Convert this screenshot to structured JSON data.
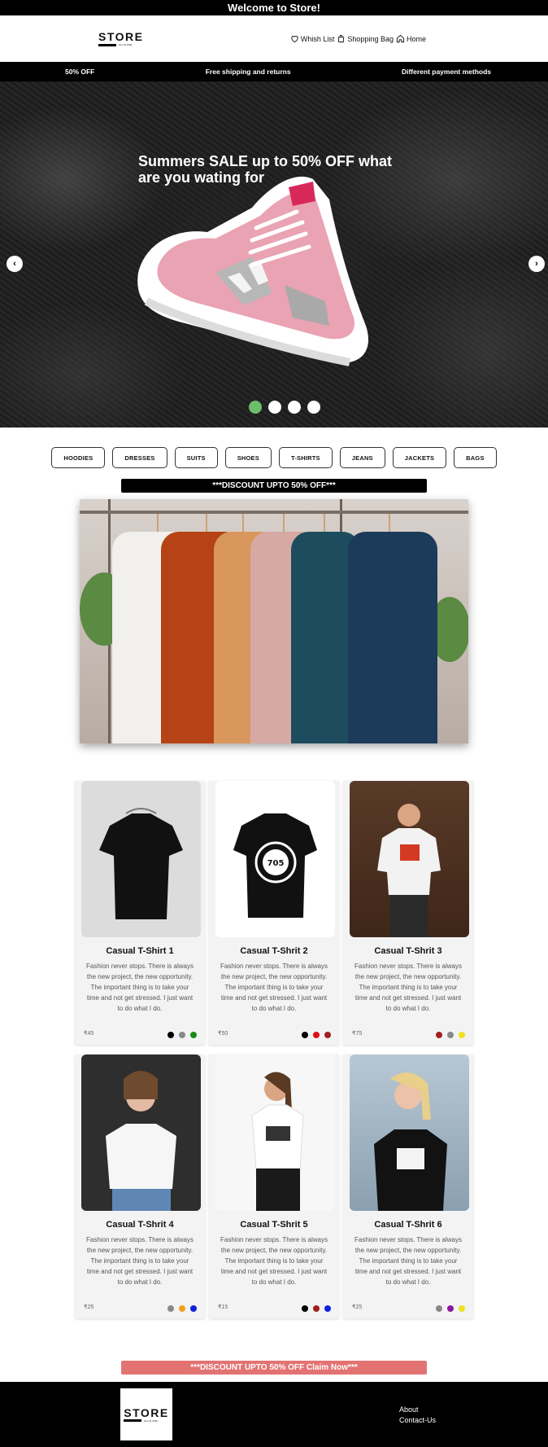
{
  "topbar": {
    "text": "Welcome to Store!"
  },
  "nav": {
    "logo": "STORE",
    "logo_tagline": "ALL IN ONE",
    "links": [
      {
        "label": "Whish List",
        "icon": "heart-icon"
      },
      {
        "label": "Shopping Bag",
        "icon": "bag-icon"
      },
      {
        "label": "Home",
        "icon": "home-icon"
      }
    ]
  },
  "promo": {
    "left": "50% OFF",
    "center": "Free shipping and returns",
    "right": "Different payment methods"
  },
  "hero": {
    "title": "Summers SALE up to 50% OFF what are you wating for",
    "prev_icon": "chevron-left-icon",
    "next_icon": "chevron-right-icon",
    "slides": 4,
    "active_slide": 1,
    "active_color": "#6bbf6b"
  },
  "categories": [
    "HOODIES",
    "DRESSES",
    "SUITS",
    "SHOES",
    "T-SHIRTS",
    "JEANS",
    "JACKETS",
    "BAGS"
  ],
  "discount_banner": "***DISCOUNT UPTO 50% OFF***",
  "products": [
    {
      "name": "Casual T-Shirt 1",
      "desc": "Fashion never stops. There is always the new project, the new opportunity. The important thing is to take your time and not get stressed. I just want to do what I do.",
      "price": "₹45",
      "colors": [
        "#000000",
        "#888888",
        "#1a8a1a"
      ]
    },
    {
      "name": "Casual T-Shrit 2",
      "desc": "Fashion never stops. There is always the new project, the new opportunity. The important thing is to take your time and not get stressed. I just want to do what I do.",
      "price": "₹50",
      "colors": [
        "#000000",
        "#e01010",
        "#a01f1f"
      ]
    },
    {
      "name": "Casual T-Shrit 3",
      "desc": "Fashion never stops. There is always the new project, the new opportunity. The important thing is to take your time and not get stressed. I just want to do what I do.",
      "price": "₹75",
      "colors": [
        "#a01f1f",
        "#888888",
        "#f0e020"
      ]
    },
    {
      "name": "Casual T-Shrit 4",
      "desc": "Fashion never stops. There is always the new project, the new opportunity. The important thing is to take your time and not get stressed. I just want to do what I do.",
      "price": "₹25",
      "colors": [
        "#888888",
        "#f0a020",
        "#1020e0"
      ]
    },
    {
      "name": "Casual T-Shrit 5",
      "desc": "Fashion never stops. There is always the new project, the new opportunity. The important thing is to take your time and not get stressed. I just want to do what I do.",
      "price": "₹15",
      "colors": [
        "#000000",
        "#a01f1f",
        "#1020e0"
      ]
    },
    {
      "name": "Casual T-Shrit 6",
      "desc": "Fashion never stops. There is always the new project, the new opportunity. The important thing is to take your time and not get stressed. I just want to do what I do.",
      "price": "₹25",
      "colors": [
        "#888888",
        "#8a1a9a",
        "#f0e020"
      ]
    }
  ],
  "claim_banner": "***DISCOUNT UPTO 50% OFF Claim Now***",
  "footer": {
    "logo": "STORE",
    "logo_tagline": "ALL IN ONE",
    "links": [
      "About",
      "Contact-Us"
    ]
  }
}
